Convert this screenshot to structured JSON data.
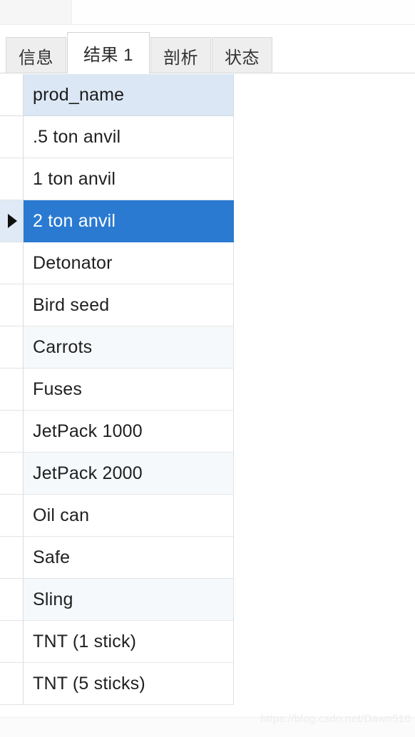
{
  "window": {
    "top_panel_label": "",
    "background_color": "#ffffff"
  },
  "tabs": {
    "items": [
      {
        "label": "信息",
        "active": false,
        "name": "tab-info"
      },
      {
        "label": "结果 1",
        "active": true,
        "name": "tab-result-1"
      },
      {
        "label": "剖析",
        "active": false,
        "name": "tab-profile"
      },
      {
        "label": "状态",
        "active": false,
        "name": "tab-status"
      }
    ],
    "active_index": 1
  },
  "result_grid": {
    "columns": [
      "prod_name"
    ],
    "header_background": "#dbe7f4",
    "selection_color": "#2a7ad2",
    "alt_row_color": "#f5f9fc",
    "selected_row_index": 2,
    "row_marker_glyph": "▶",
    "rows": [
      {
        "prod_name": ".5 ton anvil"
      },
      {
        "prod_name": "1 ton anvil"
      },
      {
        "prod_name": "2 ton anvil"
      },
      {
        "prod_name": "Detonator"
      },
      {
        "prod_name": "Bird seed"
      },
      {
        "prod_name": "Carrots"
      },
      {
        "prod_name": "Fuses"
      },
      {
        "prod_name": "JetPack 1000"
      },
      {
        "prod_name": "JetPack 2000"
      },
      {
        "prod_name": "Oil can"
      },
      {
        "prod_name": "Safe"
      },
      {
        "prod_name": "Sling"
      },
      {
        "prod_name": "TNT (1 stick)"
      },
      {
        "prod_name": "TNT (5 sticks)"
      }
    ]
  },
  "watermark": {
    "text": "https://blog.csdn.net/Dawn510"
  }
}
